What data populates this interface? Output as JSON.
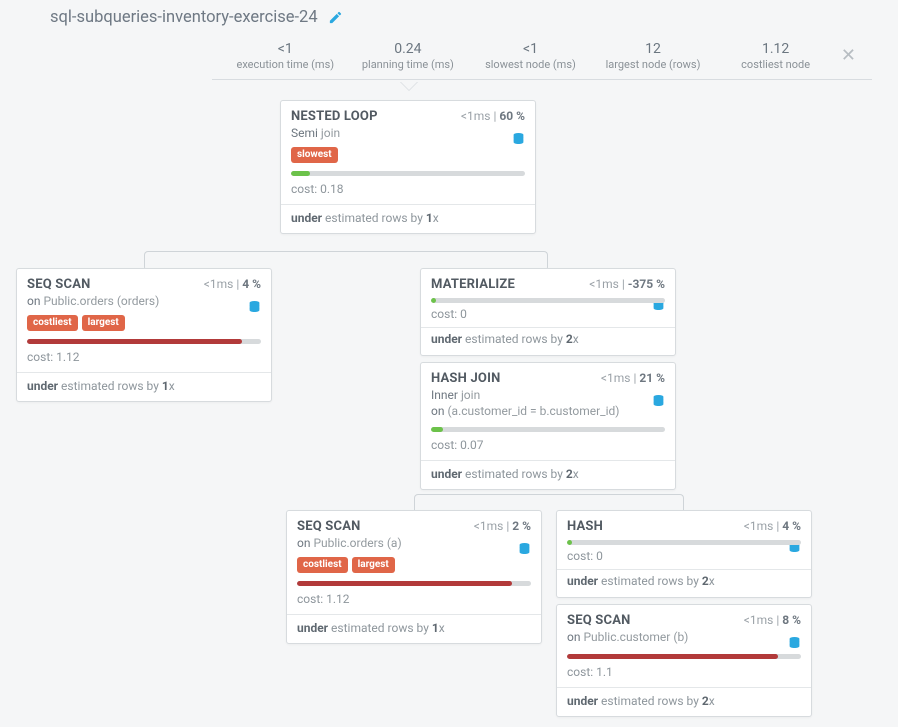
{
  "page": {
    "title": "sql-subqueries-inventory-exercise-24"
  },
  "stats": {
    "exec_time": {
      "value": "<1",
      "label": "execution time (ms)"
    },
    "plan_time": {
      "value": "0.24",
      "label": "planning time (ms)"
    },
    "slowest_node": {
      "value": "<1",
      "label": "slowest node (ms)"
    },
    "largest_node": {
      "value": "12",
      "label": "largest node (rows)"
    },
    "costliest_node": {
      "value": "1.12",
      "label": "costliest node"
    }
  },
  "common": {
    "lt1ms": "<1ms",
    "cost_prefix": "cost: ",
    "under_prefix": "under",
    "under_mid": " estimated rows by ",
    "under_suffix": "x"
  },
  "nodes": {
    "nested_loop": {
      "title": "NESTED LOOP",
      "time": "<1ms",
      "pct": "60",
      "sub_prefix": "Semi ",
      "sub_grey": "join",
      "badges": [
        "slowest"
      ],
      "bar": {
        "color": "green",
        "pct": 8
      },
      "cost": "0.18",
      "factor": "1"
    },
    "seq_scan_orders": {
      "title": "SEQ SCAN",
      "time": "<1ms",
      "pct": "4",
      "sub_prefix": "on ",
      "sub_grey": "Public.orders (orders)",
      "badges": [
        "costliest",
        "largest"
      ],
      "bar": {
        "color": "red",
        "pct": 92
      },
      "cost": "1.12",
      "factor": "1"
    },
    "materialize": {
      "title": "MATERIALIZE",
      "time": "<1ms",
      "pct": "-375",
      "bar": {
        "color": "green",
        "pct": 2
      },
      "cost": "0",
      "factor": "2"
    },
    "hash_join": {
      "title": "HASH JOIN",
      "time": "<1ms",
      "pct": "21",
      "sub_line1_prefix": "Inner ",
      "sub_line1_grey": "join",
      "sub_line2_prefix": "on ",
      "sub_line2_grey": "(a.customer_id = b.customer_id)",
      "bar": {
        "color": "green",
        "pct": 5
      },
      "cost": "0.07",
      "factor": "2"
    },
    "seq_scan_a": {
      "title": "SEQ SCAN",
      "time": "<1ms",
      "pct": "2",
      "sub_prefix": "on ",
      "sub_grey": "Public.orders (a)",
      "badges": [
        "costliest",
        "largest"
      ],
      "bar": {
        "color": "red",
        "pct": 92
      },
      "cost": "1.12",
      "factor": "1"
    },
    "hash": {
      "title": "HASH",
      "time": "<1ms",
      "pct": "4",
      "bar": {
        "color": "green",
        "pct": 2
      },
      "cost": "0",
      "factor": "2"
    },
    "seq_scan_b": {
      "title": "SEQ SCAN",
      "time": "<1ms",
      "pct": "8",
      "sub_prefix": "on ",
      "sub_grey": "Public.customer (b)",
      "bar": {
        "color": "red",
        "pct": 90
      },
      "cost": "1.1",
      "factor": "2"
    }
  }
}
